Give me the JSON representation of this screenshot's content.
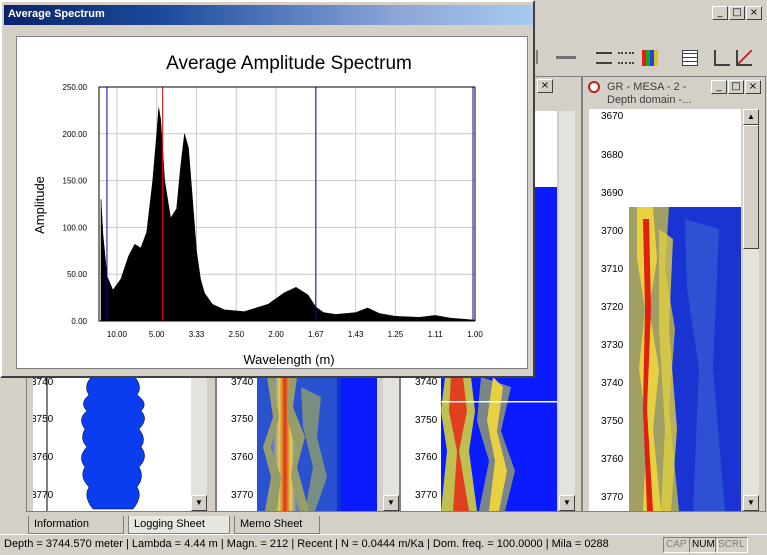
{
  "dialog": {
    "title": "Average Spectrum"
  },
  "chart_data": {
    "type": "area",
    "title": "Average Amplitude Spectrum",
    "xlabel": "Wavelength (m)",
    "ylabel": "Amplitude",
    "ylim": [
      0,
      250
    ],
    "yticks": [
      "250.00",
      "200.00",
      "150.00",
      "100.00",
      "50.00",
      "0.00"
    ],
    "xtick_labels": [
      "10.00",
      "5.00",
      "3.33",
      "2.50",
      "2.00",
      "1.67",
      "1.43",
      "1.25",
      "1.11",
      "1.00"
    ],
    "xtick_positions": [
      0.1,
      0.2,
      0.3,
      0.4,
      0.5,
      0.6,
      0.7,
      0.8,
      0.9,
      1.0
    ],
    "xlim_inverse": [
      0.055,
      1.0
    ],
    "grid": true,
    "spectrum": {
      "x": [
        0.06,
        0.065,
        0.075,
        0.09,
        0.11,
        0.13,
        0.145,
        0.16,
        0.175,
        0.19,
        0.2,
        0.205,
        0.21,
        0.22,
        0.235,
        0.25,
        0.26,
        0.27,
        0.28,
        0.29,
        0.3,
        0.31,
        0.32,
        0.34,
        0.37,
        0.42,
        0.48,
        0.52,
        0.55,
        0.58,
        0.6,
        0.62,
        0.65,
        0.7,
        0.73,
        0.76,
        0.8,
        0.86,
        0.9,
        0.94,
        0.97,
        1.0
      ],
      "y": [
        130,
        92,
        48,
        33,
        45,
        70,
        82,
        78,
        95,
        150,
        200,
        228,
        215,
        150,
        110,
        120,
        165,
        200,
        185,
        130,
        75,
        45,
        30,
        18,
        12,
        10,
        18,
        30,
        36,
        28,
        15,
        9,
        7,
        9,
        14,
        8,
        5,
        4,
        6,
        3,
        2,
        1
      ]
    },
    "markers": [
      {
        "x": 0.075,
        "color": "#0000c0"
      },
      {
        "x": 0.215,
        "color": "#ff0000"
      },
      {
        "x": 0.6,
        "color": "#0000c0"
      },
      {
        "x": 0.995,
        "color": "#0000c0"
      }
    ]
  },
  "panels": {
    "mid_title": "GR - MESA - 2 -",
    "right_title_line1": "GR - MESA - 2 -",
    "right_title_line2": "Depth domain -...",
    "left_depths": [
      "3740",
      "3750",
      "3760",
      "3770"
    ],
    "center_depths": [
      "3740",
      "3750",
      "3760",
      "3770"
    ],
    "mid_depths": [
      "3740",
      "3750",
      "3760",
      "3770"
    ],
    "right_depths": [
      "3670",
      "3680",
      "3690",
      "3700",
      "3710",
      "3720",
      "3730",
      "3740",
      "3750",
      "3760",
      "3770"
    ]
  },
  "tabs": [
    "Information",
    "Logging Sheet",
    "Memo Sheet"
  ],
  "status": {
    "text": "Depth = 3744.570 meter | Lambda = 4.44 m | Magn. = 212 | Recent | N = 0.0444 m/Ka | Dom. freq. = 100.0000 | Mila = 0288",
    "cap": "CAP",
    "num": "NUM",
    "scrl": "SCRL"
  },
  "colors": {
    "heat_low": "#1030d8",
    "heat_mid": "#f2e64a",
    "heat_high": "#e02010"
  }
}
